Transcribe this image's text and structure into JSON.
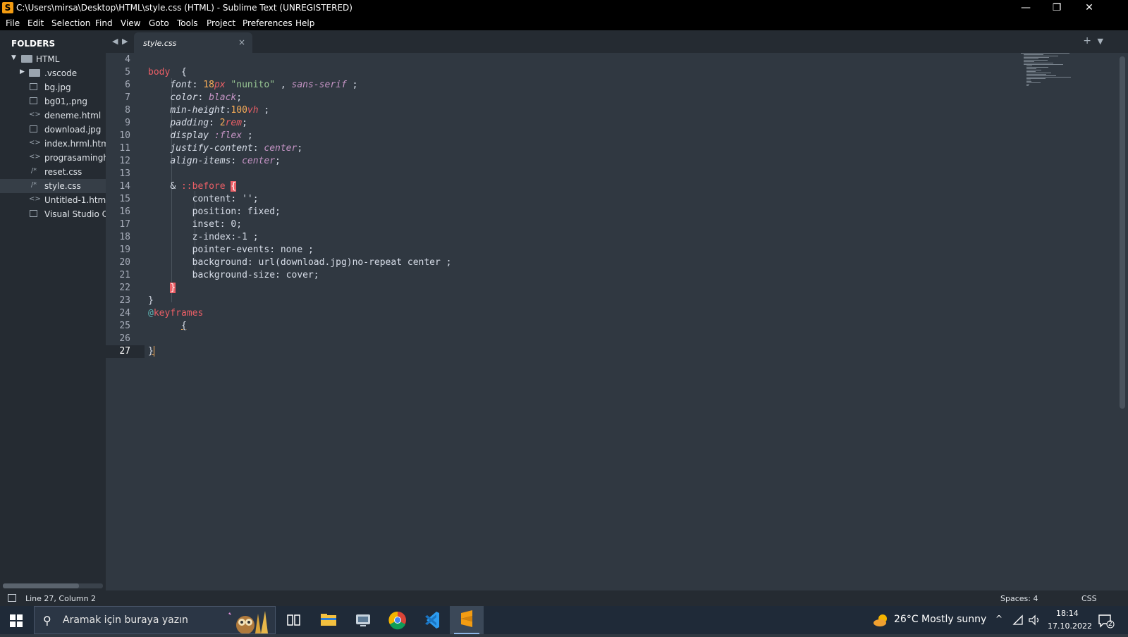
{
  "window": {
    "title": "C:\\Users\\mirsa\\Desktop\\HTML\\style.css (HTML) - Sublime Text (UNREGISTERED)",
    "minimize": "—",
    "maximize": "❐",
    "close": "✕"
  },
  "menu": [
    "File",
    "Edit",
    "Selection",
    "Find",
    "View",
    "Goto",
    "Tools",
    "Project",
    "Preferences",
    "Help"
  ],
  "sidebar": {
    "header": "FOLDERS",
    "root": "HTML",
    "items": [
      {
        "label": ".vscode",
        "type": "folder"
      },
      {
        "label": "bg.jpg",
        "type": "image"
      },
      {
        "label": "bg01,.png",
        "type": "image"
      },
      {
        "label": "deneme.html",
        "type": "code"
      },
      {
        "label": "download.jpg",
        "type": "image"
      },
      {
        "label": "index.hrml.html",
        "type": "code"
      },
      {
        "label": "prograsaminghu",
        "type": "code"
      },
      {
        "label": "reset.css",
        "type": "css"
      },
      {
        "label": "style.css",
        "type": "css",
        "selected": true
      },
      {
        "label": "Untitled-1.html",
        "type": "code"
      },
      {
        "label": "Visual Studio Co",
        "type": "doc"
      }
    ]
  },
  "tab": {
    "name": "style.css",
    "close": "×"
  },
  "editor": {
    "line_numbers": [
      "4",
      "5",
      "6",
      "7",
      "8",
      "9",
      "10",
      "11",
      "12",
      "13",
      "14",
      "15",
      "16",
      "17",
      "18",
      "19",
      "20",
      "21",
      "22",
      "23",
      "24",
      "25",
      "26",
      "27"
    ],
    "current_line": "27",
    "code": {
      "l5_sel": "body",
      "l5_brace": "{",
      "l6_prop": "font",
      "l6_num": "18",
      "l6_unit": "px",
      "l6_str": "\"nunito\"",
      "l6_val": "sans-serif",
      "l7_prop": "color",
      "l7_val": "black",
      "l8_prop": "min-height",
      "l8_num": "100",
      "l8_unit": "vh",
      "l9_prop": "padding",
      "l9_num": "2",
      "l9_unit": "rem",
      "l10_prop": "display",
      "l10_val": ":flex",
      "l11_prop": "justify-content",
      "l11_val": "center",
      "l12_prop": "align-items",
      "l12_val": "center",
      "l14_amp": "&",
      "l14_pseudo": "::before",
      "l14_brace": "{",
      "l15": "content: '';",
      "l16": "position: fixed;",
      "l17": "inset: 0;",
      "l18": "z-index:-1 ;",
      "l19": "pointer-events: none ;",
      "l20": "background: url(download.jpg)no-repeat center ;",
      "l21": "background-size: cover;",
      "l22_brace": "}",
      "l23": "}",
      "l24_at": "@",
      "l24_kw": "keyframes",
      "l25": "{",
      "l27": "}"
    }
  },
  "status": {
    "position": "Line 27, Column 2",
    "spaces": "Spaces: 4",
    "syntax": "CSS"
  },
  "taskbar": {
    "search_placeholder": "Aramak için buraya yazın",
    "weather": "26°C  Mostly sunny",
    "time": "18:14",
    "date": "17.10.2022",
    "notifications": "2"
  },
  "colors": {
    "editor_bg": "#303841",
    "sidebar_bg": "#252b32",
    "selector": "#ec5f66",
    "value": "#c594c5",
    "number": "#f9ae58",
    "string": "#99c794",
    "at_rule": "#5fb3b3"
  }
}
